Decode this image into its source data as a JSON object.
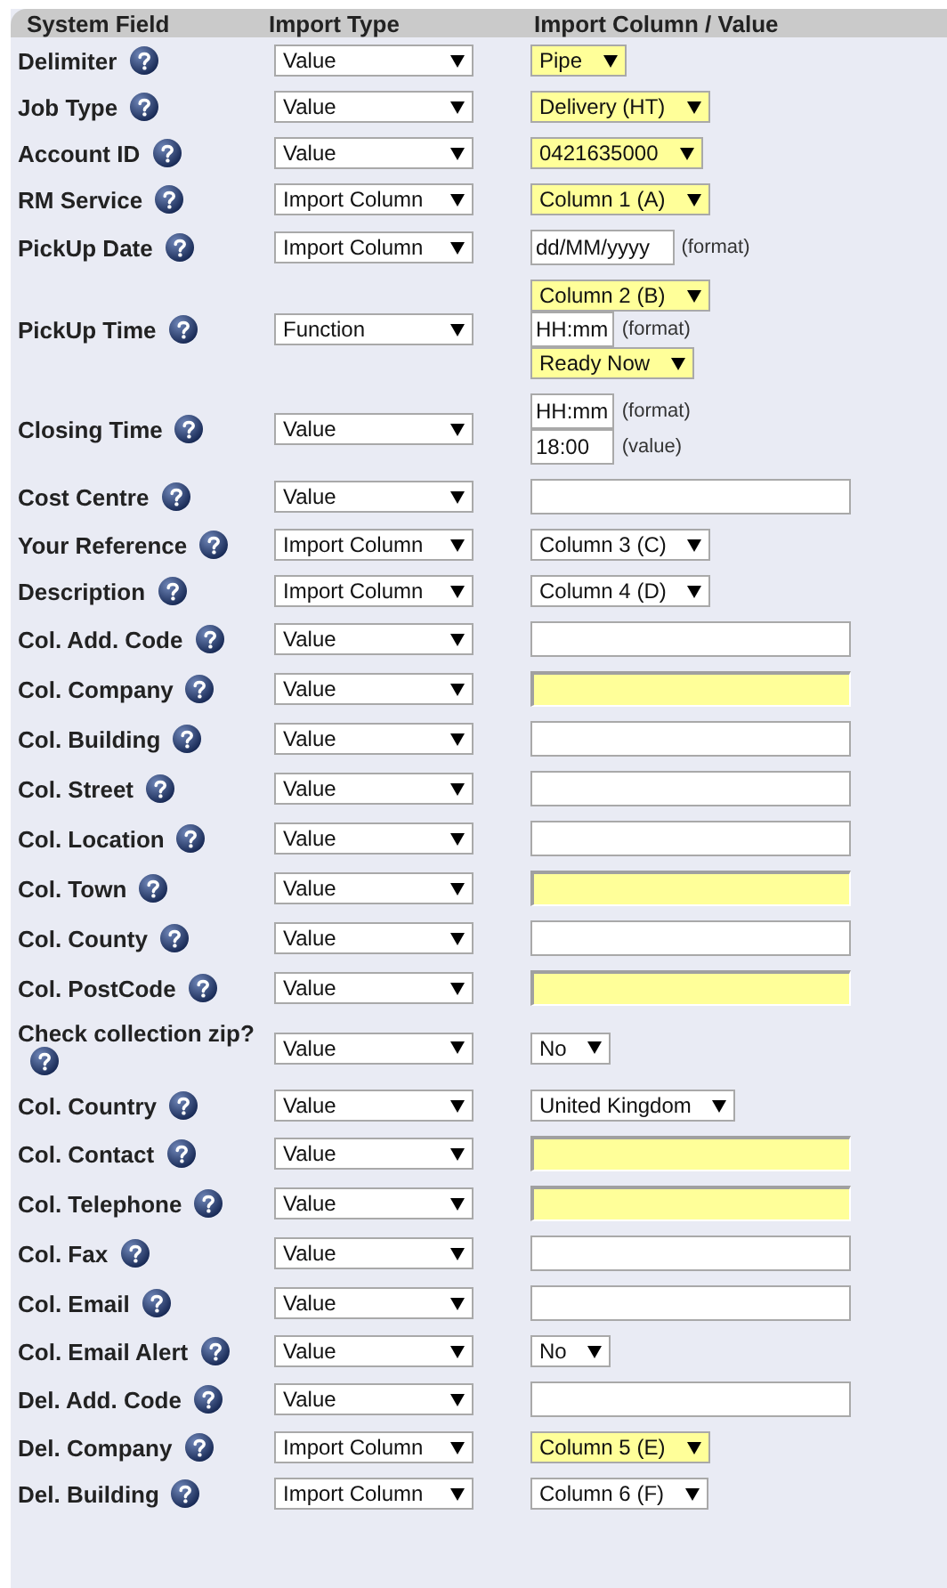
{
  "header": {
    "columns": [
      "System Field",
      "Import Type",
      "Import Column / Value"
    ]
  },
  "rows": [
    {
      "label": "Delimiter",
      "import_type": "Value",
      "inputs": [
        {
          "kind": "select",
          "value": "Pipe",
          "required": true
        }
      ]
    },
    {
      "label": "Job Type",
      "import_type": "Value",
      "inputs": [
        {
          "kind": "select",
          "value": "Delivery (HT)",
          "required": true
        }
      ]
    },
    {
      "label": "Account ID",
      "import_type": "Value",
      "inputs": [
        {
          "kind": "select",
          "value": "0421635000",
          "required": true
        }
      ]
    },
    {
      "label": "RM Service",
      "import_type": "Import Column",
      "inputs": [
        {
          "kind": "select",
          "value": "Column 1 (A)",
          "required": true
        }
      ]
    },
    {
      "label": "PickUp Date",
      "import_type": "Import Column",
      "inputs": [
        {
          "kind": "text",
          "value": "dd/MM/yyyy",
          "required": false,
          "note": "(format)"
        }
      ]
    },
    {
      "label": "PickUp Time",
      "import_type": "Function",
      "inputs": [
        {
          "kind": "select",
          "value": "Column 2 (B)",
          "required": true
        },
        {
          "kind": "text",
          "value": "HH:mm",
          "required": false,
          "note": "(format)"
        },
        {
          "kind": "select",
          "value": "Ready Now",
          "required": true
        }
      ]
    },
    {
      "label": "Closing Time",
      "import_type": "Value",
      "inputs": [
        {
          "kind": "text",
          "value": "HH:mm",
          "required": false,
          "note": "(format)"
        },
        {
          "kind": "text",
          "value": "18:00",
          "required": false,
          "note": "(value)"
        }
      ]
    },
    {
      "label": "Cost Centre",
      "import_type": "Value",
      "inputs": [
        {
          "kind": "text",
          "required": false
        }
      ]
    },
    {
      "label": "Your Reference",
      "import_type": "Import Column",
      "inputs": [
        {
          "kind": "select",
          "value": "Column 3 (C)",
          "required": false
        }
      ]
    },
    {
      "label": "Description",
      "import_type": "Import Column",
      "inputs": [
        {
          "kind": "select",
          "value": "Column 4 (D)",
          "required": false
        }
      ]
    },
    {
      "label": "Col. Add. Code",
      "import_type": "Value",
      "inputs": [
        {
          "kind": "text",
          "required": false
        }
      ]
    },
    {
      "label": "Col. Company",
      "import_type": "Value",
      "inputs": [
        {
          "kind": "text",
          "required": true
        }
      ]
    },
    {
      "label": "Col. Building",
      "import_type": "Value",
      "inputs": [
        {
          "kind": "text",
          "required": false
        }
      ]
    },
    {
      "label": "Col. Street",
      "import_type": "Value",
      "inputs": [
        {
          "kind": "text",
          "required": false
        }
      ]
    },
    {
      "label": "Col. Location",
      "import_type": "Value",
      "inputs": [
        {
          "kind": "text",
          "required": false
        }
      ]
    },
    {
      "label": "Col. Town",
      "import_type": "Value",
      "inputs": [
        {
          "kind": "text",
          "required": true
        }
      ]
    },
    {
      "label": "Col. County",
      "import_type": "Value",
      "inputs": [
        {
          "kind": "text",
          "required": false
        }
      ]
    },
    {
      "label": "Col. PostCode",
      "import_type": "Value",
      "inputs": [
        {
          "kind": "text",
          "required": true
        }
      ]
    },
    {
      "label": "Check collection zip?",
      "import_type": "Value",
      "inputs": [
        {
          "kind": "select",
          "value": "No",
          "required": false
        }
      ]
    },
    {
      "label": "Col. Country",
      "import_type": "Value",
      "inputs": [
        {
          "kind": "select",
          "value": "United Kingdom",
          "required": false
        }
      ]
    },
    {
      "label": "Col. Contact",
      "import_type": "Value",
      "inputs": [
        {
          "kind": "text",
          "required": true
        }
      ]
    },
    {
      "label": "Col. Telephone",
      "import_type": "Value",
      "inputs": [
        {
          "kind": "text",
          "required": true
        }
      ]
    },
    {
      "label": "Col. Fax",
      "import_type": "Value",
      "inputs": [
        {
          "kind": "text",
          "required": false
        }
      ]
    },
    {
      "label": "Col. Email",
      "import_type": "Value",
      "inputs": [
        {
          "kind": "text",
          "required": false
        }
      ]
    },
    {
      "label": "Col. Email Alert",
      "import_type": "Value",
      "inputs": [
        {
          "kind": "select",
          "value": "No",
          "required": false
        }
      ]
    },
    {
      "label": "Del. Add. Code",
      "import_type": "Value",
      "inputs": [
        {
          "kind": "text",
          "required": false
        }
      ]
    },
    {
      "label": "Del. Company",
      "import_type": "Import Column",
      "inputs": [
        {
          "kind": "select",
          "value": "Column 5 (E)",
          "required": true
        }
      ]
    },
    {
      "label": "Del. Building",
      "import_type": "Import Column",
      "inputs": [
        {
          "kind": "select",
          "value": "Column 6 (F)",
          "required": false
        }
      ]
    }
  ]
}
